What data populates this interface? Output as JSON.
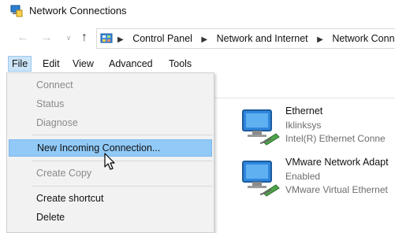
{
  "window": {
    "title": "Network Connections"
  },
  "address": {
    "crumbs": [
      "Control Panel",
      "Network and Internet",
      "Network Conn"
    ]
  },
  "menubar": {
    "items": [
      {
        "label": "File",
        "active": true
      },
      {
        "label": "Edit"
      },
      {
        "label": "View"
      },
      {
        "label": "Advanced"
      },
      {
        "label": "Tools"
      }
    ]
  },
  "file_menu": {
    "items": [
      {
        "label": "Connect",
        "enabled": false
      },
      {
        "label": "Status",
        "enabled": false
      },
      {
        "label": "Diagnose",
        "enabled": false
      },
      {
        "label": "New Incoming Connection...",
        "enabled": true,
        "highlighted": true
      },
      {
        "label": "Create Copy",
        "enabled": false
      },
      {
        "label": "Create shortcut",
        "enabled": true
      },
      {
        "label": "Delete",
        "enabled": true
      }
    ]
  },
  "connections": [
    {
      "name": "Ethernet",
      "status": "Iklinksys",
      "device": "Intel(R) Ethernet Conne"
    },
    {
      "name": "VMware Network Adapt",
      "status": "Enabled",
      "device": "VMware Virtual Ethernet"
    }
  ],
  "colors": {
    "menu_highlight": "#91c9f7",
    "menubar_active": "#cce4f7",
    "disabled_text": "#8a8a8a"
  },
  "icons": [
    "network-connections-icon",
    "back-arrow-icon",
    "forward-arrow-icon",
    "up-arrow-icon",
    "control-panel-icon",
    "network-adapter-icon",
    "mouse-cursor-icon"
  ]
}
